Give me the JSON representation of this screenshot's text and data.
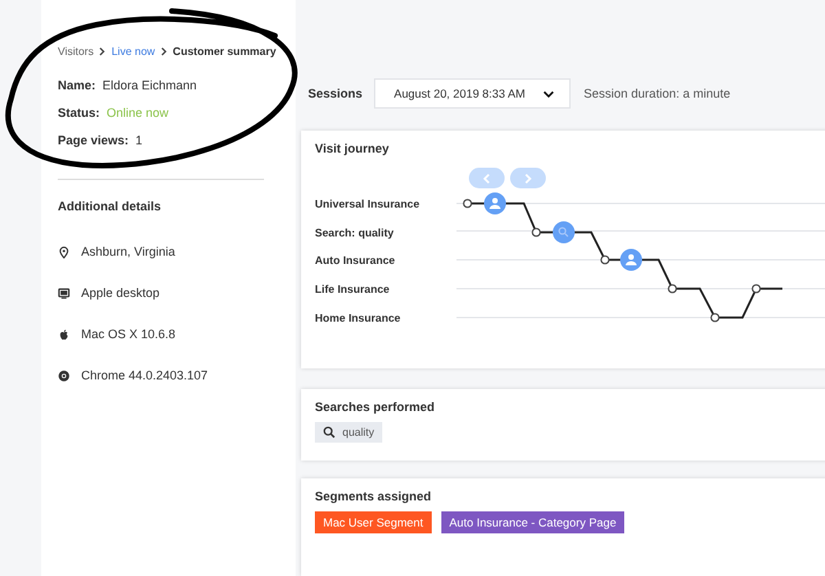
{
  "breadcrumb": [
    {
      "label": "Visitors",
      "link": false
    },
    {
      "label": "Live now",
      "link": true
    },
    {
      "label": "Customer summary",
      "link": false
    }
  ],
  "profile": {
    "name_label": "Name:",
    "name": "Eldora Eichmann",
    "status_label": "Status:",
    "status": "Online now",
    "online": true,
    "views_label": "Page views:",
    "views": "1"
  },
  "details": {
    "title": "Additional details",
    "items": [
      {
        "kind": "location",
        "text": "Ashburn, Virginia"
      },
      {
        "kind": "desktop",
        "text": "Apple desktop"
      },
      {
        "kind": "apple",
        "text": "Mac OS X 10.6.8"
      },
      {
        "kind": "browser",
        "text": "Chrome 44.0.2403.107"
      }
    ]
  },
  "sessions": {
    "label": "Sessions",
    "selected": "August 20, 2019 8:33 AM",
    "duration": "Session duration: a minute"
  },
  "journey": {
    "title": "Visit journey",
    "pages": [
      "Universal Insurance",
      "Search: quality",
      "Auto Insurance",
      "Life Insurance",
      "Home Insurance"
    ]
  },
  "searches": {
    "title": "Searches performed",
    "items": [
      "quality"
    ]
  },
  "segments": {
    "title": "Segments assigned",
    "items": [
      {
        "label": "Mac User Segment",
        "color": "#fe5722"
      },
      {
        "label": "Auto Insurance - Category Page",
        "color": "#7e57c2"
      }
    ]
  }
}
